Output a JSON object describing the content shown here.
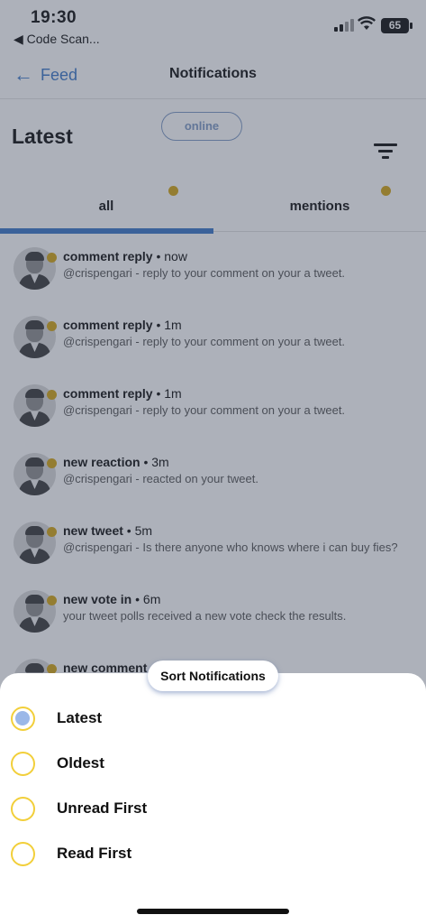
{
  "status_bar": {
    "time": "19:30",
    "back_app": "◀ Code Scan...",
    "battery": "65"
  },
  "nav": {
    "back_label": "Feed",
    "title": "Notifications"
  },
  "online_label": "online",
  "heading": "Latest",
  "tabs": [
    {
      "label": "all"
    },
    {
      "label": "mentions"
    }
  ],
  "notifications": [
    {
      "type": "comment reply",
      "time": "• now",
      "message": "@crispengari - reply to your comment on your a tweet."
    },
    {
      "type": "comment reply",
      "time": "• 1m",
      "message": "@crispengari - reply to your comment on your a tweet."
    },
    {
      "type": "comment reply",
      "time": "• 1m",
      "message": "@crispengari - reply to your comment on your a tweet."
    },
    {
      "type": "new reaction",
      "time": "• 3m",
      "message": "@crispengari - reacted on your tweet."
    },
    {
      "type": "new tweet",
      "time": "• 5m",
      "message": "@crispengari - Is there anyone who knows where i can buy fies?"
    },
    {
      "type": "new vote in",
      "time": "• 6m",
      "message": "your tweet polls received a new vote check the results."
    },
    {
      "type": "new comment",
      "time": "",
      "message": ""
    }
  ],
  "sort_sheet": {
    "title": "Sort Notifications",
    "options": [
      {
        "label": "Latest",
        "selected": true
      },
      {
        "label": "Oldest",
        "selected": false
      },
      {
        "label": "Unread First",
        "selected": false
      },
      {
        "label": "Read First",
        "selected": false
      }
    ]
  },
  "colors": {
    "accent": "#3b78c9",
    "dot": "#d4a514",
    "radio_border": "#f2cf3a",
    "radio_fill": "#9bb8e8"
  }
}
